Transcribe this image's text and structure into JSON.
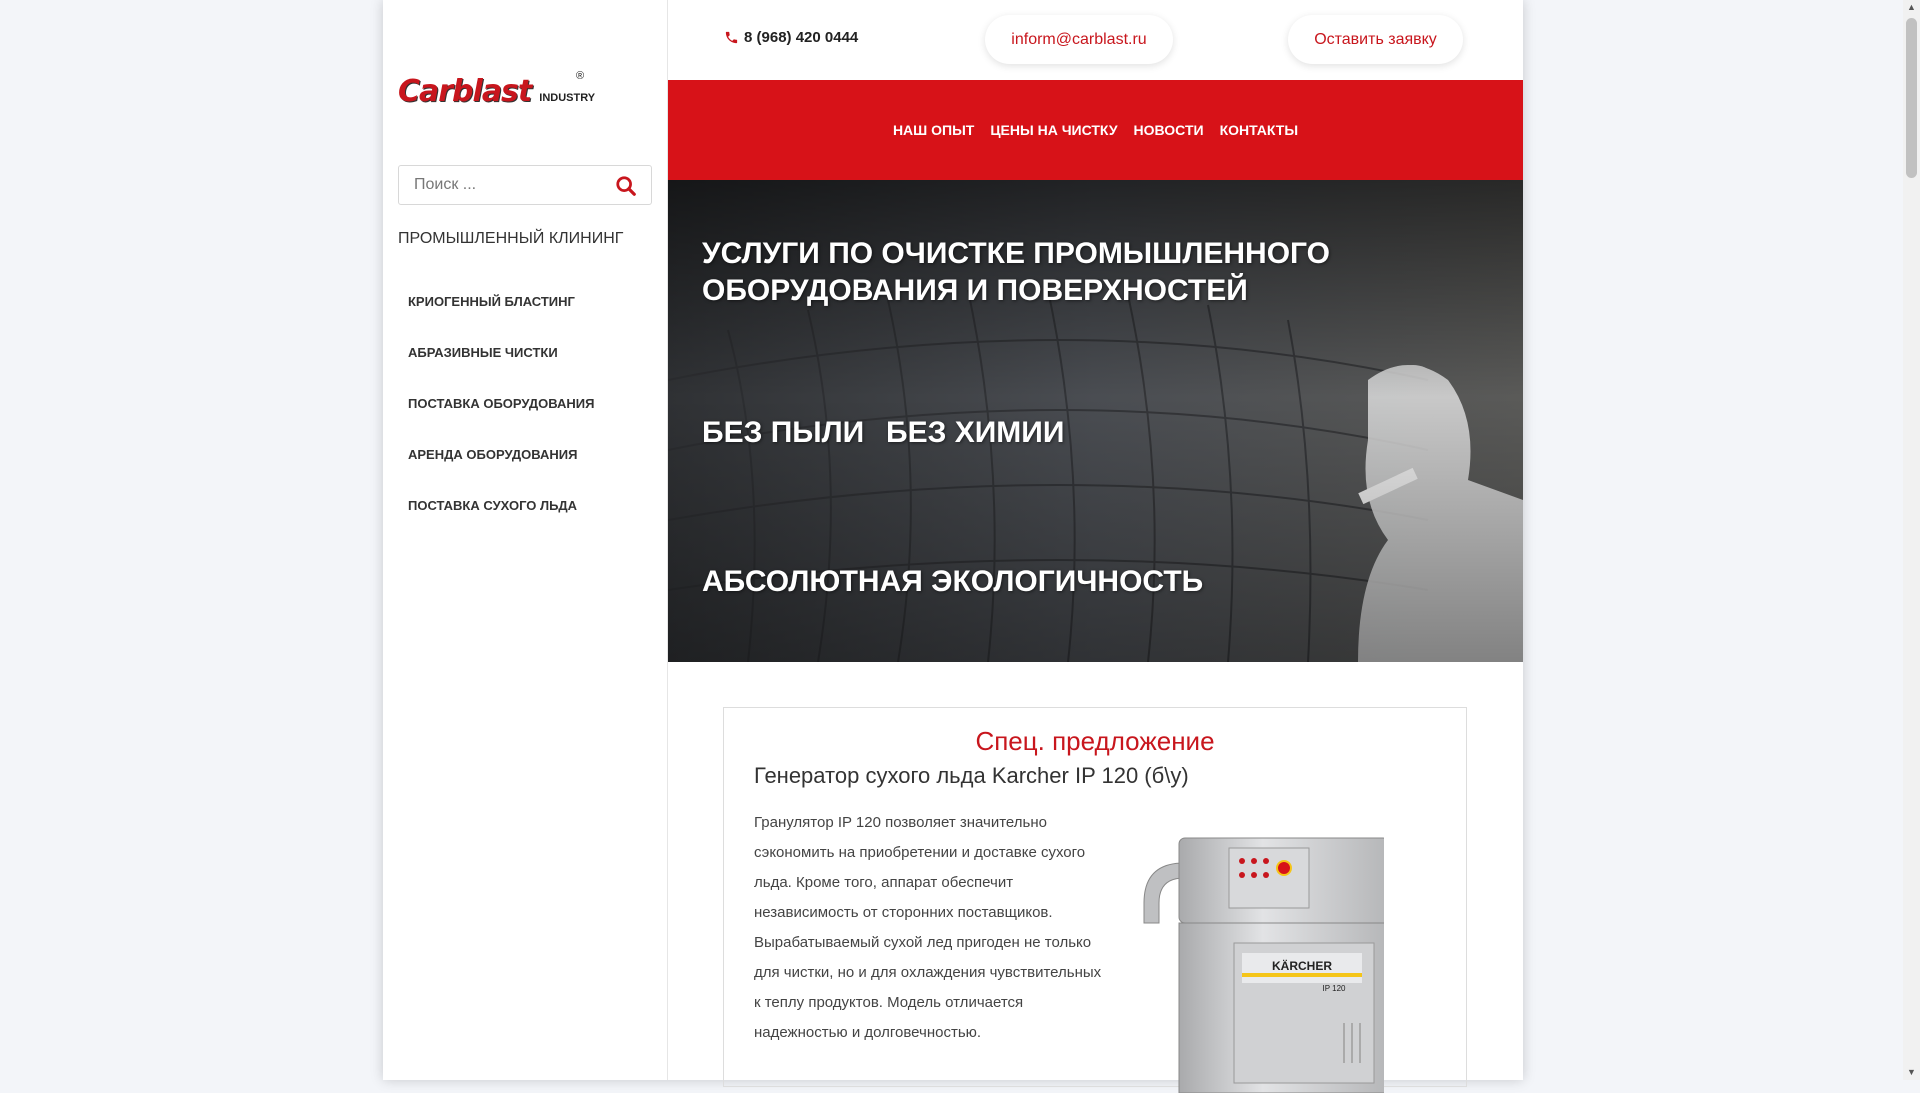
{
  "sidebar": {
    "logo_text": "Carblast",
    "logo_sub": "INDUSTRY",
    "logo_reg": "®",
    "search_placeholder": "Поиск ...",
    "heading": "ПРОМЫШЛЕННЫЙ КЛИНИНГ",
    "items": [
      {
        "label": "КРИОГЕННЫЙ БЛАСТИНГ"
      },
      {
        "label": "АБРАЗИВНЫЕ ЧИСТКИ"
      },
      {
        "label": "ПОСТАВКА ОБОРУДОВАНИЯ"
      },
      {
        "label": "АРЕНДА ОБОРУДОВАНИЯ"
      },
      {
        "label": "ПОСТАВКА СУХОГО ЛЬДА"
      }
    ]
  },
  "header": {
    "phone": "8 (968) 420 0444",
    "email": "inform@carblast.ru",
    "request_button": "Оставить заявку"
  },
  "nav": {
    "items": [
      {
        "label": "НАШ ОПЫТ"
      },
      {
        "label": "ЦЕНЫ НА ЧИСТКУ"
      },
      {
        "label": "НОВОСТИ"
      },
      {
        "label": "КОНТАКТЫ"
      }
    ]
  },
  "hero": {
    "title": "УСЛУГИ ПО ОЧИСТКЕ ПРОМЫШЛЕННОГО ОБОРУДОВАНИЯ И ПОВЕРХНОСТЕЙ",
    "tag1": "БЕЗ ПЫЛИ",
    "tag2": "БЕЗ ХИМИИ",
    "tag3": "АБСОЛЮТНАЯ ЭКОЛОГИЧНОСТЬ"
  },
  "offer": {
    "title": "Спец. предложение",
    "subtitle": "Генератор сухого льда Karcher IP 120 (б\\у)",
    "text": "Гранулятор IP 120 позволяет значительно сэкономить на приобретении и доставке сухого льда. Кроме того, аппарат обеспечит независимость от сторонних поставщиков. Вырабатываемый сухой лед пригоден не только для чистки, но и для охлаждения чувствительных к теплу продуктов. Модель отличается надежностью и долговечностью.",
    "product_brand": "KÄRCHER",
    "product_model": "IP 120"
  },
  "colors": {
    "brand_red": "#d71218",
    "text_dark": "#333333"
  },
  "icons": {
    "phone": "phone-icon",
    "search": "search-icon"
  }
}
